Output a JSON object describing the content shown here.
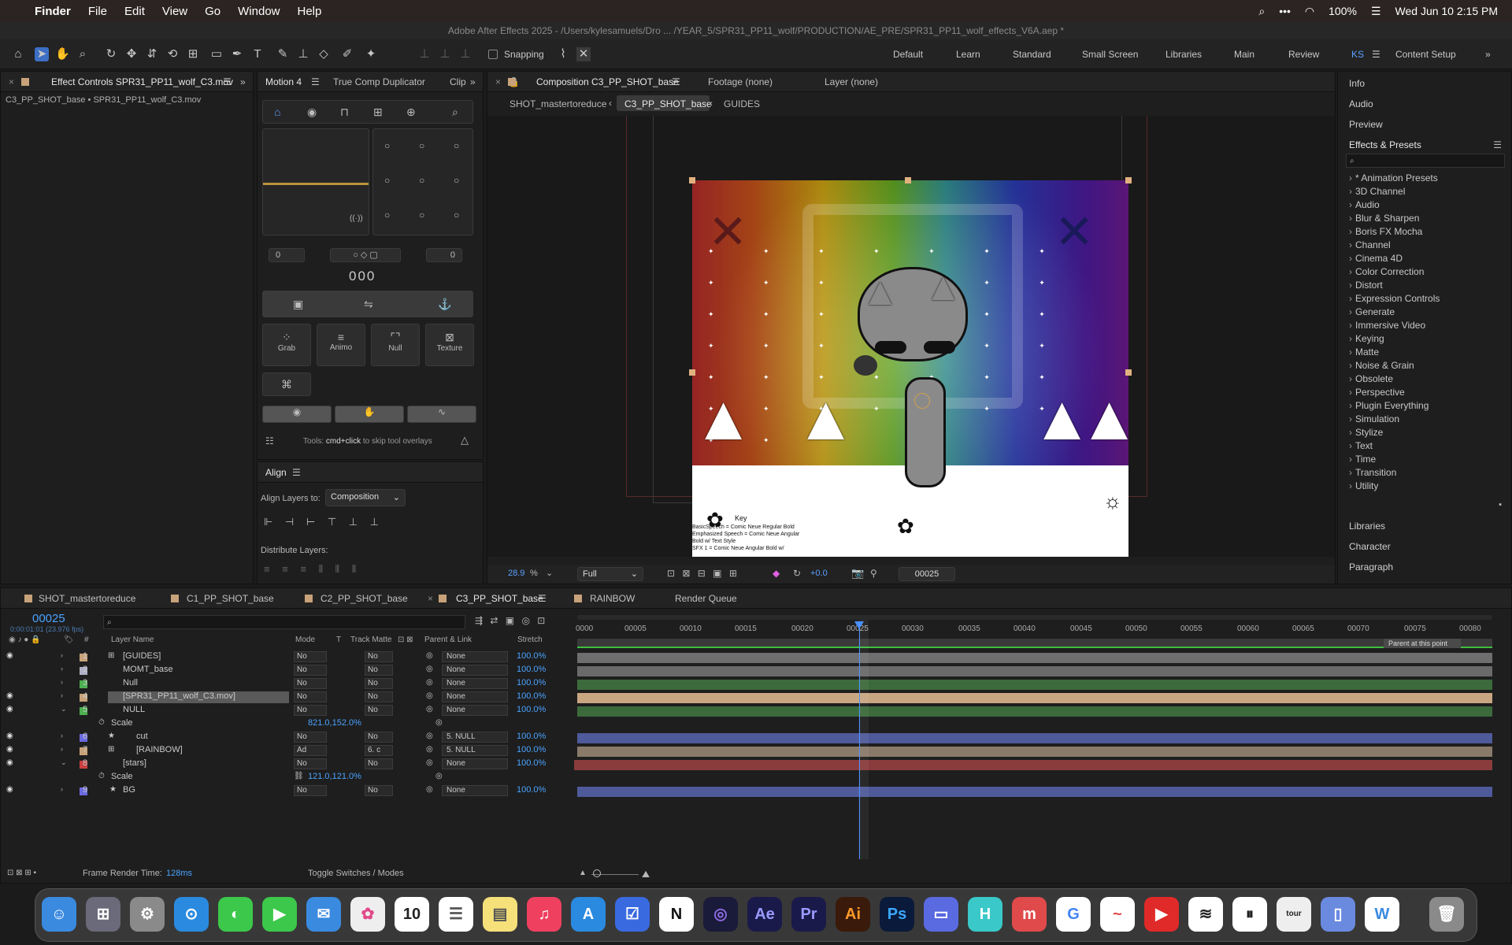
{
  "menubar": {
    "app": "Finder",
    "items": [
      "File",
      "Edit",
      "View",
      "Go",
      "Window",
      "Help"
    ],
    "battery": "100%",
    "datetime": "Wed Jun 10  2:15 PM"
  },
  "window_title": "Adobe After Effects 2025 - /Users/kylesamuels/Dro ... /YEAR_5/SPR31_PP11_wolf/PRODUCTION/AE_PRE/SPR31_PP11_wolf_effects_V6A.aep *",
  "toolbar": {
    "snapping": "Snapping",
    "workspaces": [
      "Default",
      "Learn",
      "Standard",
      "Small Screen",
      "Libraries",
      "Main",
      "Review",
      "KS",
      "Content Setup"
    ]
  },
  "effect_controls": {
    "tab": "Effect Controls SPR31_PP11_wolf_C3.mov",
    "subtitle": "C3_PP_SHOT_base • SPR31_PP11_wolf_C3.mov"
  },
  "motion": {
    "tabs": [
      "Motion 4",
      "True Comp Duplicator",
      "Clip"
    ],
    "field_left": "0",
    "field_right": "0",
    "counter": "000",
    "tools": [
      "Grab",
      "Animo",
      "Null",
      "Texture"
    ],
    "hint_prefix": "Tools:",
    "hint_key": "cmd+click",
    "hint_suffix": "to skip tool overlays"
  },
  "align": {
    "title": "Align",
    "align_to_label": "Align Layers to:",
    "align_to": "Composition",
    "distribute": "Distribute Layers:"
  },
  "composition": {
    "tab": "Composition C3_PP_SHOT_base",
    "footage": "Footage (none)",
    "layer": "Layer (none)",
    "breadcrumbs": [
      "SHOT_mastertoreduce",
      "C3_PP_SHOT_base",
      "GUIDES"
    ],
    "zoom": "28.9",
    "resolution": "Full",
    "exposure": "+0.0",
    "timecode": "00025",
    "key_title": "Key",
    "key_lines": [
      "BasicSpeech = Comic Neue Regular Bold",
      "Emphasized Speech = Comic Neue Angular Bold w/ Text Style",
      "SFX 1 = Comic Neue Angular Bold w/"
    ]
  },
  "right_panel": {
    "top": [
      "Info",
      "Audio",
      "Preview"
    ],
    "effects_title": "Effects & Presets",
    "effects": [
      "* Animation Presets",
      "3D Channel",
      "Audio",
      "Blur & Sharpen",
      "Boris FX Mocha",
      "Channel",
      "Cinema 4D",
      "Color Correction",
      "Distort",
      "Expression Controls",
      "Generate",
      "Immersive Video",
      "Keying",
      "Matte",
      "Noise & Grain",
      "Obsolete",
      "Perspective",
      "Plugin Everything",
      "Simulation",
      "Stylize",
      "Text",
      "Time",
      "Transition",
      "Utility"
    ],
    "bottom": [
      "Libraries",
      "Character",
      "Paragraph"
    ]
  },
  "timeline": {
    "tabs": [
      "SHOT_mastertoreduce",
      "C1_PP_SHOT_base",
      "C2_PP_SHOT_base",
      "C3_PP_SHOT_base",
      "RAINBOW",
      "Render Queue"
    ],
    "current_time": "00025",
    "fps": "0:00:01:01 (23.976 fps)",
    "headers": {
      "layer_name": "Layer Name",
      "mode": "Mode",
      "t": "T",
      "track_matte": "Track Matte",
      "parent": "Parent & Link",
      "stretch": "Stretch"
    },
    "ruler": [
      "0000",
      "00005",
      "00010",
      "00015",
      "00020",
      "00025",
      "00030",
      "00035",
      "00040",
      "00045",
      "00050",
      "00055",
      "00060",
      "00065",
      "00070",
      "00075",
      "00080"
    ],
    "parent_tooltip": "Parent at this point",
    "layers": [
      {
        "num": "1",
        "name": "[GUIDES]",
        "color": "#c8a27a",
        "mode": "No",
        "tm": "No",
        "parent": "None",
        "stretch": "100.0%",
        "bar": "#6e6e6e"
      },
      {
        "num": "2",
        "name": "MOMT_base",
        "color": "#b0b0c8",
        "mode": "No",
        "tm": "No",
        "parent": "None",
        "stretch": "100.0%",
        "bar": "#6a6a6a"
      },
      {
        "num": "3",
        "name": "Null",
        "color": "#4caf50",
        "mode": "No",
        "tm": "No",
        "parent": "None",
        "stretch": "100.0%",
        "bar": "#3c6a3c"
      },
      {
        "num": "4",
        "name": "[SPR31_PP11_wolf_C3.mov]",
        "color": "#c8a27a",
        "mode": "No",
        "tm": "No",
        "parent": "None",
        "stretch": "100.0%",
        "bar": "#c8a682"
      },
      {
        "num": "5",
        "name": "NULL",
        "color": "#4caf50",
        "mode": "No",
        "tm": "No",
        "parent": "None",
        "stretch": "100.0%",
        "bar": "#3c6a3c"
      },
      {
        "num": "6",
        "name": "cut",
        "color": "#6a6ae0",
        "mode": "No",
        "tm": "No",
        "parent": "5. NULL",
        "stretch": "100.0%",
        "bar": "#4e5a9a"
      },
      {
        "num": "7",
        "name": "[RAINBOW]",
        "color": "#c8a27a",
        "mode": "Ad",
        "tm": "6. c",
        "parent": "5. NULL",
        "stretch": "100.0%",
        "bar": "#8a7a6a"
      },
      {
        "num": "8",
        "name": "[stars]",
        "color": "#c84040",
        "mode": "No",
        "tm": "No",
        "parent": "None",
        "stretch": "100.0%",
        "bar": "#8a3c3c"
      },
      {
        "num": "9",
        "name": "BG",
        "color": "#6a6ae0",
        "mode": "No",
        "tm": "No",
        "parent": "None",
        "stretch": "100.0%",
        "bar": "#4e5a9a"
      }
    ],
    "scale_label": "Scale",
    "scale5": "821.0,152.0%",
    "scale8": "121.0,121.0%",
    "footer": {
      "render_label": "Frame Render Time:",
      "render_value": "128ms",
      "toggle": "Toggle Switches / Modes"
    }
  }
}
